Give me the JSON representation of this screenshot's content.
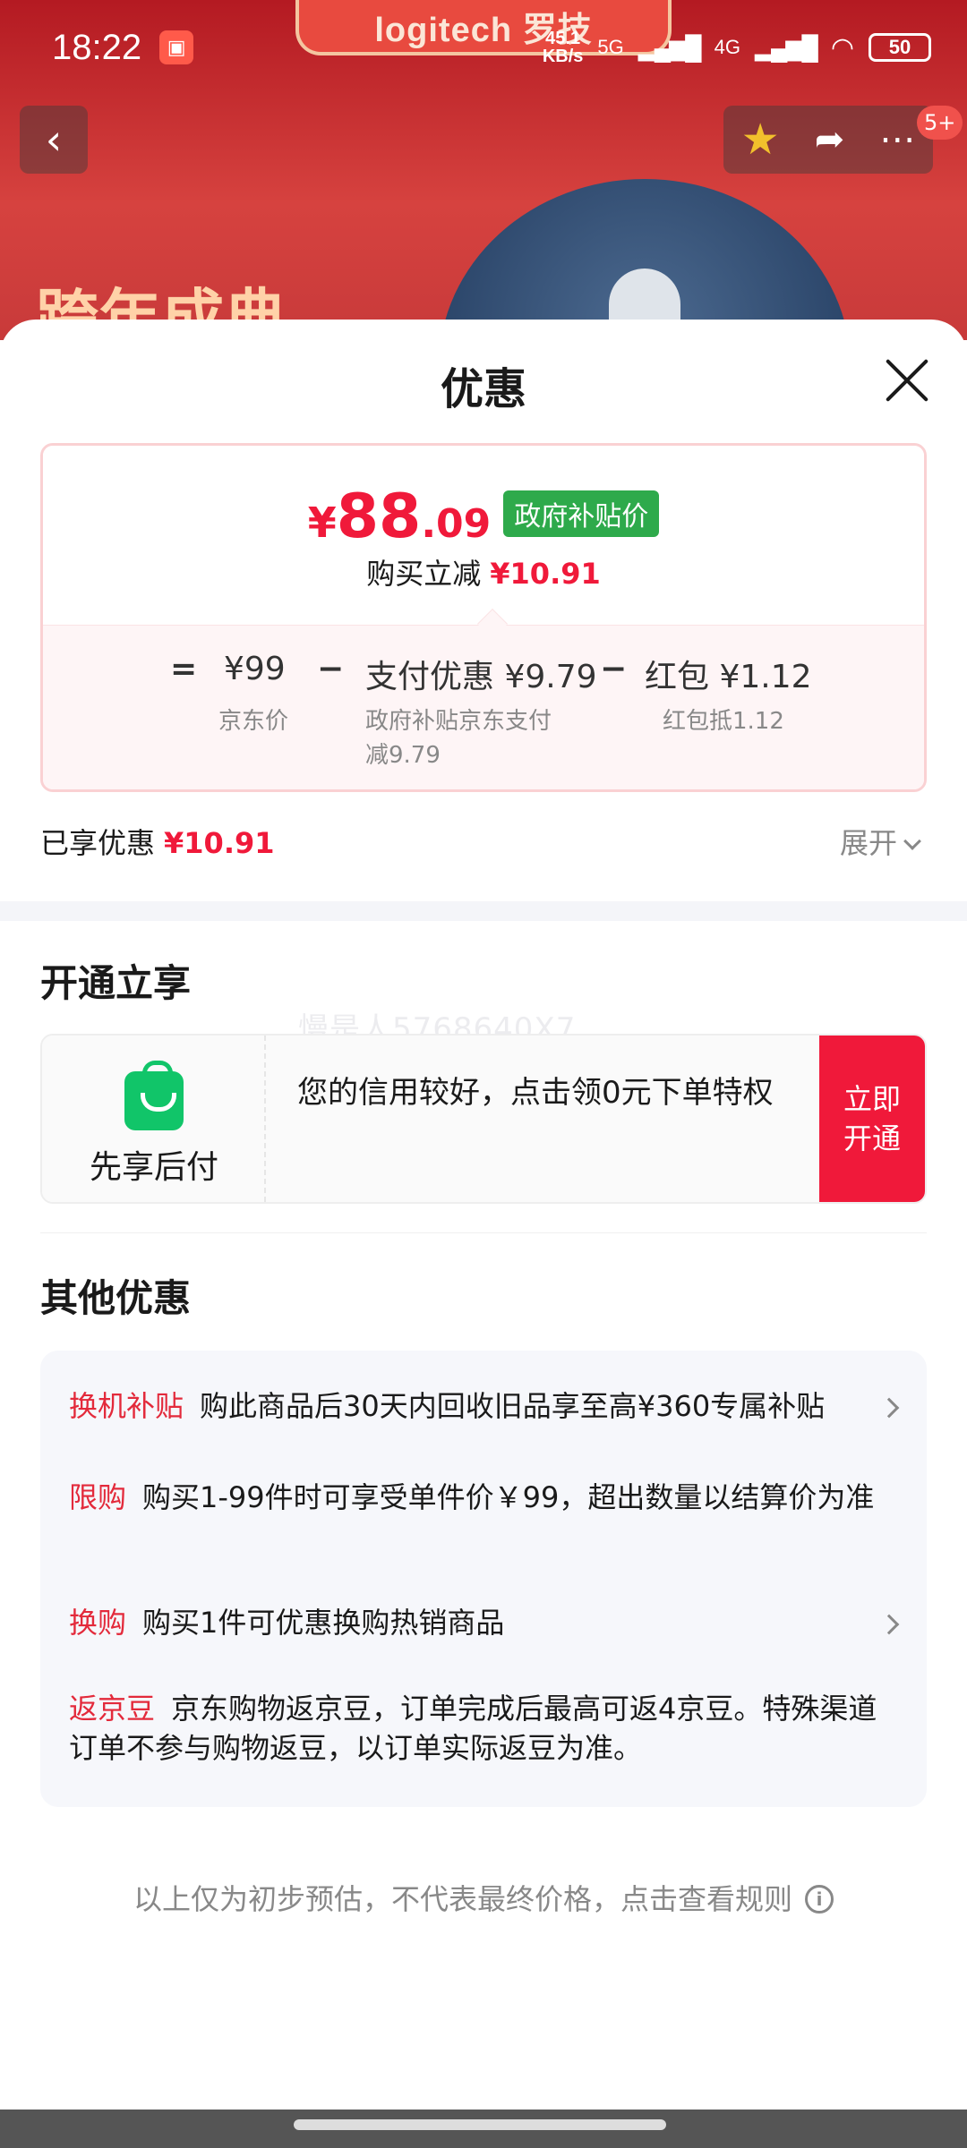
{
  "status_bar": {
    "time": "18:22",
    "net_speed_top": "45.1",
    "net_speed_bottom": "KB/s",
    "net_5g": "5G",
    "net_4g": "4G",
    "battery": "50"
  },
  "background": {
    "brand_text": "logitech 罗技",
    "promo_text": "跨年成典"
  },
  "nav": {
    "back_icon": "chevron-left-icon",
    "favorite_icon": "star-icon",
    "share_icon": "share-icon",
    "more_icon": "more-icon",
    "message_badge": "5+"
  },
  "sheet": {
    "title": "优惠",
    "price": {
      "currency": "¥",
      "integer": "88",
      "decimal": ".09",
      "tag": "政府补贴价",
      "cut_label": "购买立减",
      "cut_value": "¥10.91"
    },
    "breakdown": {
      "eq": "=",
      "minus": "−",
      "jd_price": "¥99",
      "jd_price_label": "京东价",
      "pay_discount": "支付优惠 ¥9.79",
      "pay_discount_desc_1": "政府补贴京东支付",
      "pay_discount_desc_2": "减9.79",
      "redpacket": "红包 ¥1.12",
      "redpacket_desc": "红包抵1.12"
    },
    "enjoyed_label": "已享优惠",
    "enjoyed_value": "¥10.91",
    "expand_label": "展开",
    "open_section": {
      "title": "开通立享",
      "watermark": "慢是人5768640X7",
      "product_label": "先享后付",
      "description": "您的信用较好，点击领0元下单特权",
      "button": "立即开通"
    },
    "other_section": {
      "title": "其他优惠",
      "items": [
        {
          "tag": "换机补贴",
          "text": "购此商品后30天内回收旧品享至高¥360专属补贴"
        },
        {
          "tag": "限购",
          "text": "购买1-99件时可享受单件价￥99，超出数量以结算价为准"
        },
        {
          "tag": "换购",
          "text": "购买1件可优惠换购热销商品"
        },
        {
          "tag": "返京豆",
          "text": "京东购物返京豆，订单完成后最高可返4京豆。特殊渠道订单不参与购物返豆，以订单实际返豆为准。"
        }
      ]
    },
    "footer_note": "以上仅为初步预估，不代表最终价格，点击查看规则",
    "info_icon": "i"
  },
  "colors": {
    "accent_red": "#f0193a",
    "gov_green": "#2eaa4b",
    "bag_green": "#11c569"
  }
}
